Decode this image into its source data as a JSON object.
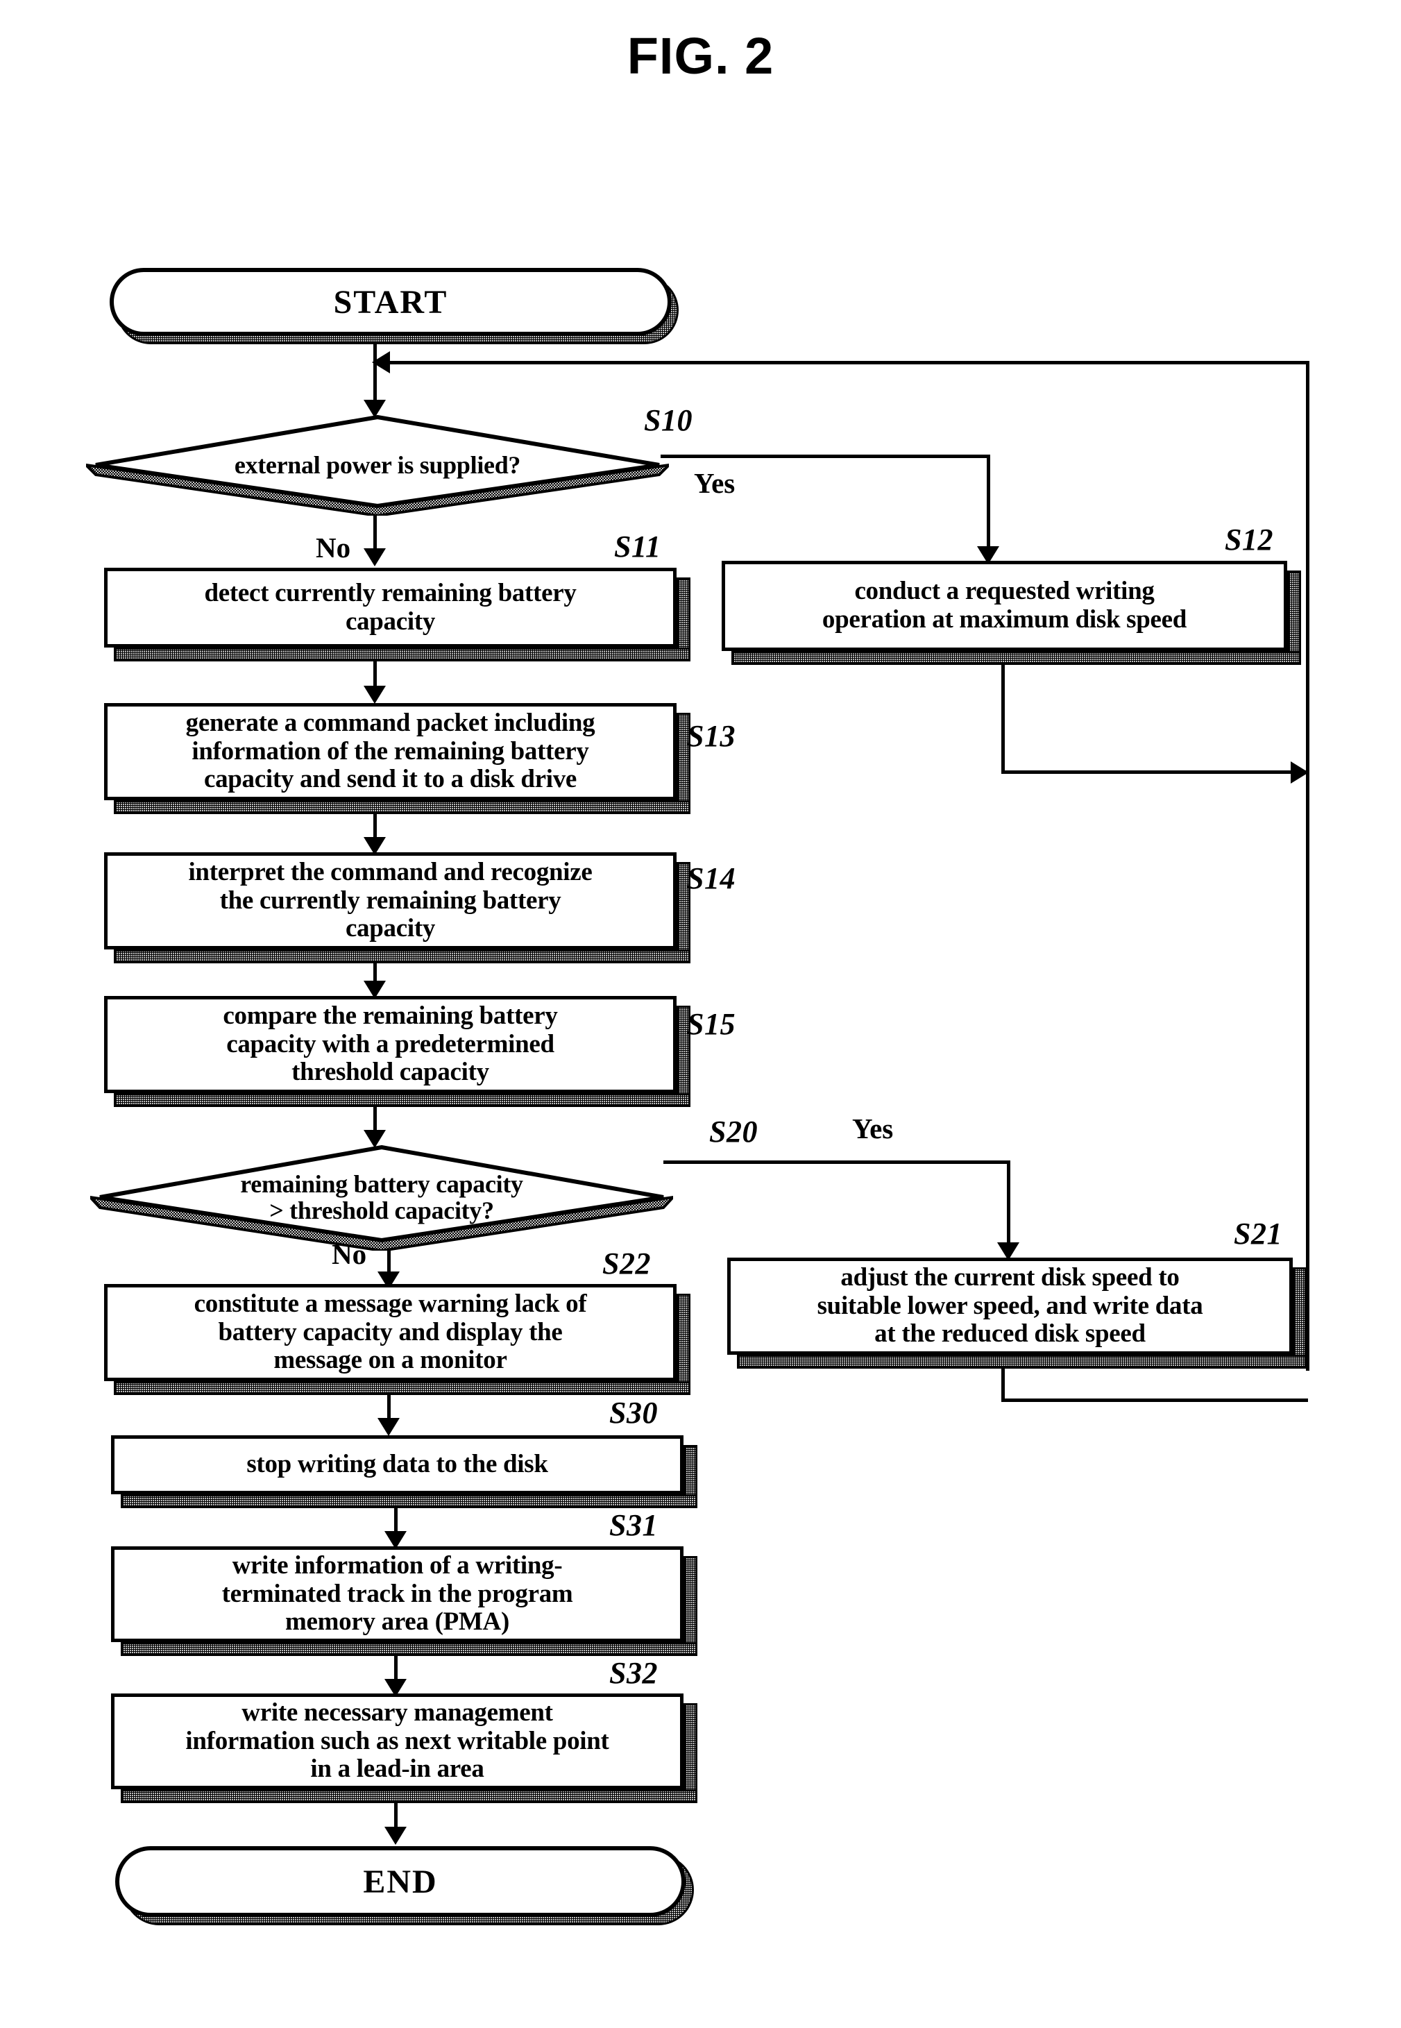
{
  "figure": {
    "title": "FIG. 2"
  },
  "nodes": {
    "start": {
      "label": "START",
      "type": "terminator"
    },
    "end": {
      "label": "END",
      "type": "terminator"
    },
    "s10": {
      "ref": "S10",
      "type": "decision",
      "line1": "external power is supplied?",
      "line2": "",
      "yes_label": "Yes",
      "no_label": "No"
    },
    "s11": {
      "ref": "S11",
      "type": "process",
      "text": "detect currently remaining battery\ncapacity"
    },
    "s12": {
      "ref": "S12",
      "type": "process",
      "text": "conduct a requested writing\noperation at maximum disk speed"
    },
    "s13": {
      "ref": "S13",
      "type": "process",
      "text": "generate a command packet including\ninformation of the remaining battery\ncapacity and send it to a disk drive"
    },
    "s14": {
      "ref": "S14",
      "type": "process",
      "text": "interpret the command and recognize\nthe currently remaining battery\ncapacity"
    },
    "s15": {
      "ref": "S15",
      "type": "process",
      "text": "compare the remaining battery\ncapacity with a predetermined\nthreshold capacity"
    },
    "s20": {
      "ref": "S20",
      "type": "decision",
      "line1": "remaining battery capacity",
      "line2": "> threshold capacity?",
      "yes_label": "Yes",
      "no_label": "No"
    },
    "s21": {
      "ref": "S21",
      "type": "process",
      "text": "adjust the current disk speed to\nsuitable lower speed, and write data\nat the reduced disk speed"
    },
    "s22": {
      "ref": "S22",
      "type": "process",
      "text": "constitute a message warning lack of\nbattery capacity and display the\nmessage on a monitor"
    },
    "s30": {
      "ref": "S30",
      "type": "process",
      "text": "stop writing data to the disk"
    },
    "s31": {
      "ref": "S31",
      "type": "process",
      "text": "write information of a writing-\nterminated track in the program\nmemory area (PMA)"
    },
    "s32": {
      "ref": "S32",
      "type": "process",
      "text": "write necessary management\ninformation such as next writable point\nin a lead-in area"
    }
  },
  "colors": {
    "ink": "#000000",
    "paper": "#ffffff",
    "shadow": "#bdbdbd"
  }
}
